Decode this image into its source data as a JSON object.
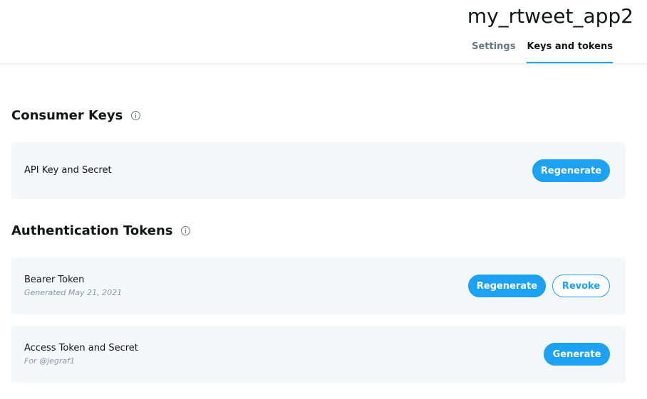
{
  "app": {
    "title": "my_rtweet_app2"
  },
  "tabs": [
    {
      "label": "Settings",
      "active": false
    },
    {
      "label": "Keys and tokens",
      "active": true
    }
  ],
  "consumer_keys": {
    "title": "Consumer Keys",
    "items": [
      {
        "label": "API Key and Secret",
        "actions": [
          "Regenerate"
        ]
      }
    ]
  },
  "auth_tokens": {
    "title": "Authentication Tokens",
    "items": [
      {
        "label": "Bearer Token",
        "sub": "Generated May 21, 2021",
        "actions": [
          "Regenerate",
          "Revoke"
        ]
      },
      {
        "label": "Access Token and Secret",
        "sub": "For @jegraf1",
        "actions": [
          "Generate"
        ]
      }
    ]
  },
  "colors": {
    "accent": "#1da1f2",
    "card_bg": "#f5f8fa",
    "muted_text": "#657786"
  }
}
